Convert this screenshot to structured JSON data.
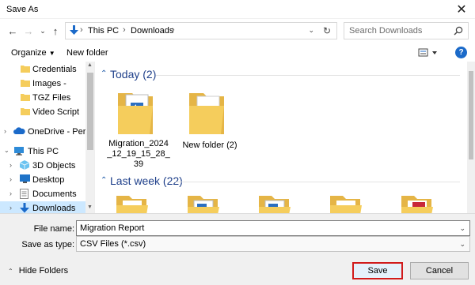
{
  "window": {
    "title": "Save As"
  },
  "address": {
    "crumbs": [
      "This PC",
      "Downloads"
    ]
  },
  "search": {
    "placeholder": "Search Downloads"
  },
  "toolbar": {
    "organize": "Organize",
    "new_folder": "New folder",
    "help": "?"
  },
  "nav": {
    "items": [
      {
        "label": "Credentials",
        "icon": "folder-icon"
      },
      {
        "label": "Images -",
        "icon": "folder-icon"
      },
      {
        "label": "TGZ Files",
        "icon": "folder-icon"
      },
      {
        "label": "Video Script",
        "icon": "folder-icon"
      },
      {
        "label": "OneDrive - Persor",
        "icon": "onedrive-icon"
      },
      {
        "label": "This PC",
        "icon": "this-pc-icon"
      },
      {
        "label": "3D Objects",
        "icon": "3d-objects-icon"
      },
      {
        "label": "Desktop",
        "icon": "desktop-icon"
      },
      {
        "label": "Documents",
        "icon": "documents-icon"
      },
      {
        "label": "Downloads",
        "icon": "downloads-icon",
        "selected": true
      }
    ]
  },
  "content": {
    "groups": [
      {
        "title": "Today (2)",
        "items": [
          {
            "name": "Migration_2024_12_19_15_28_39"
          },
          {
            "name": "New folder (2)"
          }
        ]
      },
      {
        "title": "Last week (22)",
        "items": []
      }
    ]
  },
  "form": {
    "file_name_label": "File name:",
    "file_name_value": "Migration Report",
    "save_type_label": "Save as type:",
    "save_type_value": "CSV Files (*.csv)"
  },
  "footer": {
    "hide_folders": "Hide Folders",
    "save": "Save",
    "cancel": "Cancel"
  },
  "colors": {
    "accent": "#1b6ac9",
    "selection": "#cce8ff",
    "save_highlight": "#d11b1b",
    "folder": "#f5cd5c"
  }
}
